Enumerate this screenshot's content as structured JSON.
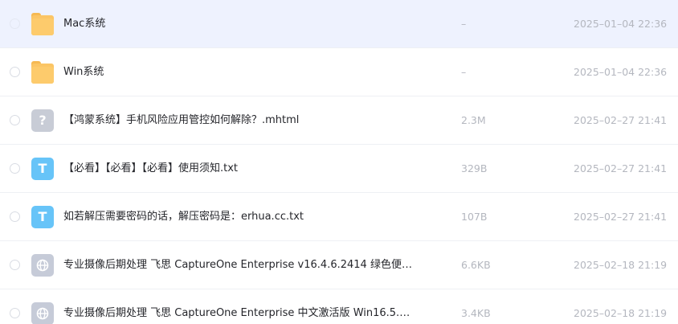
{
  "files": [
    {
      "name": "Mac系统",
      "icon": "folder-icon",
      "size": "–",
      "date": "2025–01–04 22:36",
      "selected": true
    },
    {
      "name": "Win系统",
      "icon": "folder-icon",
      "size": "–",
      "date": "2025–01–04 22:36"
    },
    {
      "name": "【鸿蒙系统】手机风险应用管控如何解除？.mhtml",
      "icon": "unknown-file-icon",
      "glyph": "?",
      "size": "2.3M",
      "date": "2025–02–27 21:41"
    },
    {
      "name": "【必看】【必看】【必看】使用须知.txt",
      "icon": "text-file-icon",
      "glyph": "T",
      "size": "329B",
      "date": "2025–02–27 21:41"
    },
    {
      "name": "如若解压需要密码的话，解压密码是：erhua.cc.txt",
      "icon": "text-file-icon",
      "glyph": "T",
      "size": "107B",
      "date": "2025–02–27 21:41"
    },
    {
      "name": "专业摄像后期处理 飞思 CaptureOne Enterprise v16.4.6.2414 绿色便…",
      "icon": "web-file-icon",
      "size": "6.6KB",
      "date": "2025–02–18 21:19"
    },
    {
      "name": "专业摄像后期处理 飞思 CaptureOne Enterprise 中文激活版 Win16.5.…",
      "icon": "web-file-icon",
      "size": "3.4KB",
      "date": "2025–02–18 21:19"
    }
  ]
}
